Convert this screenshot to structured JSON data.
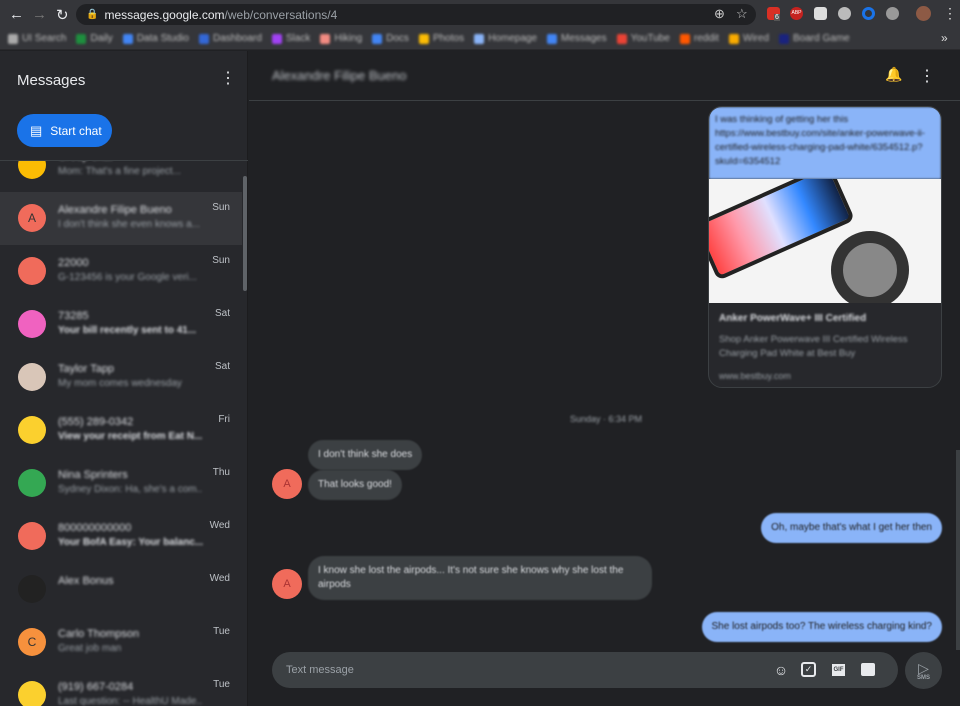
{
  "browser": {
    "url_host": "messages.google.com",
    "url_path": "/web/conversations/4",
    "extension_badge": "6",
    "extension_abp": "ABP",
    "bookmarks": [
      {
        "label": "UI Search",
        "color": "#aaaaaa"
      },
      {
        "label": "Daily",
        "color": "#1e8e3e"
      },
      {
        "label": "Data Studio",
        "color": "#4285f4"
      },
      {
        "label": "Dashboard",
        "color": "#3367d6"
      },
      {
        "label": "Slack",
        "color": "#a142f4"
      },
      {
        "label": "Hiking",
        "color": "#f28b82"
      },
      {
        "label": "Docs",
        "color": "#4285f4"
      },
      {
        "label": "Photos",
        "color": "#fbbc04"
      },
      {
        "label": "Homepage",
        "color": "#8ab4f8"
      },
      {
        "label": "Messages",
        "color": "#4285f4"
      },
      {
        "label": "YouTube",
        "color": "#ea4335"
      },
      {
        "label": "reddit",
        "color": "#ff5700"
      },
      {
        "label": "Wired",
        "color": "#f9ab00"
      },
      {
        "label": "Board Game",
        "color": "#1a237e"
      }
    ],
    "more_bookmarks": "»"
  },
  "sidebar": {
    "title": "Messages",
    "start_chat": "Start chat",
    "conversations": [
      {
        "name": "Group chat",
        "preview": "Mom: That's a fine project...",
        "date": "",
        "color": "#fbbc04",
        "initial": ""
      },
      {
        "name": "Alexandre Filipe Bueno",
        "preview": "I don't think she even knows a...",
        "date": "Sun",
        "color": "#f06b5b",
        "initial": "A"
      },
      {
        "name": "22000",
        "preview": "G-123456 is your Google veri...",
        "date": "Sun",
        "color": "#f06b5b",
        "initial": ""
      },
      {
        "name": "73285",
        "preview": "Your bill recently sent to 41...",
        "date": "Sat",
        "color": "#f062c0",
        "initial": "",
        "unread": true
      },
      {
        "name": "Taylor Tapp",
        "preview": "My mom comes wednesday",
        "date": "Sat",
        "color": "#d9c6b8",
        "initial": ""
      },
      {
        "name": "(555) 289-0342",
        "preview": "View your receipt from Eat N...",
        "date": "Fri",
        "color": "#fbd02e",
        "initial": "",
        "unread": true
      },
      {
        "name": "Nina Sprinters",
        "preview": "Sydney Dixon: Ha, she's a com...",
        "date": "Thu",
        "color": "#34a853",
        "initial": ""
      },
      {
        "name": "800000000000",
        "preview": "Your BofA Easy: Your balanc...",
        "date": "Wed",
        "color": "#f06b5b",
        "initial": "",
        "unread": true
      },
      {
        "name": "Alex Bonus",
        "preview": "",
        "date": "Wed",
        "color": "#222222",
        "initial": ""
      },
      {
        "name": "Carlo Thompson",
        "preview": "Great job man",
        "date": "Tue",
        "color": "#f6913d",
        "initial": "C"
      },
      {
        "name": "(919) 667-0284",
        "preview": "Last question: -- HealthU Made...",
        "date": "Tue",
        "color": "#fbd02e",
        "initial": ""
      }
    ]
  },
  "conversation": {
    "title": "Alexandre Filipe Bueno",
    "link_card": {
      "message": "I was thinking of getting her this https://www.bestbuy.com/site/anker-powerwave-ii-certified-wireless-charging-pad-white/6354512.p?skuId=6354512",
      "title": "Anker PowerWave+ III Certified",
      "description": "Shop Anker Powerwave III Certified Wireless Charging Pad White at Best Buy",
      "domain": "www.bestbuy.com"
    },
    "timestamp": "Sunday · 6:34 PM",
    "messages": [
      {
        "dir": "in",
        "text": "I don't think she does"
      },
      {
        "dir": "in",
        "text": "That looks good!"
      },
      {
        "dir": "out",
        "text": "Oh, maybe that's what I get her then"
      },
      {
        "dir": "in",
        "text": "I know she lost the airpods... It's not sure she knows why she lost the airpods"
      },
      {
        "dir": "out",
        "text": "She lost airpods too? The wireless charging kind?"
      }
    ],
    "input_placeholder": "Text message",
    "send_label": "SMS"
  },
  "colors": {
    "accent": "#1a73e8",
    "outgoing": "#8ab4f8",
    "incoming": "#3c4043",
    "background": "#202124"
  }
}
